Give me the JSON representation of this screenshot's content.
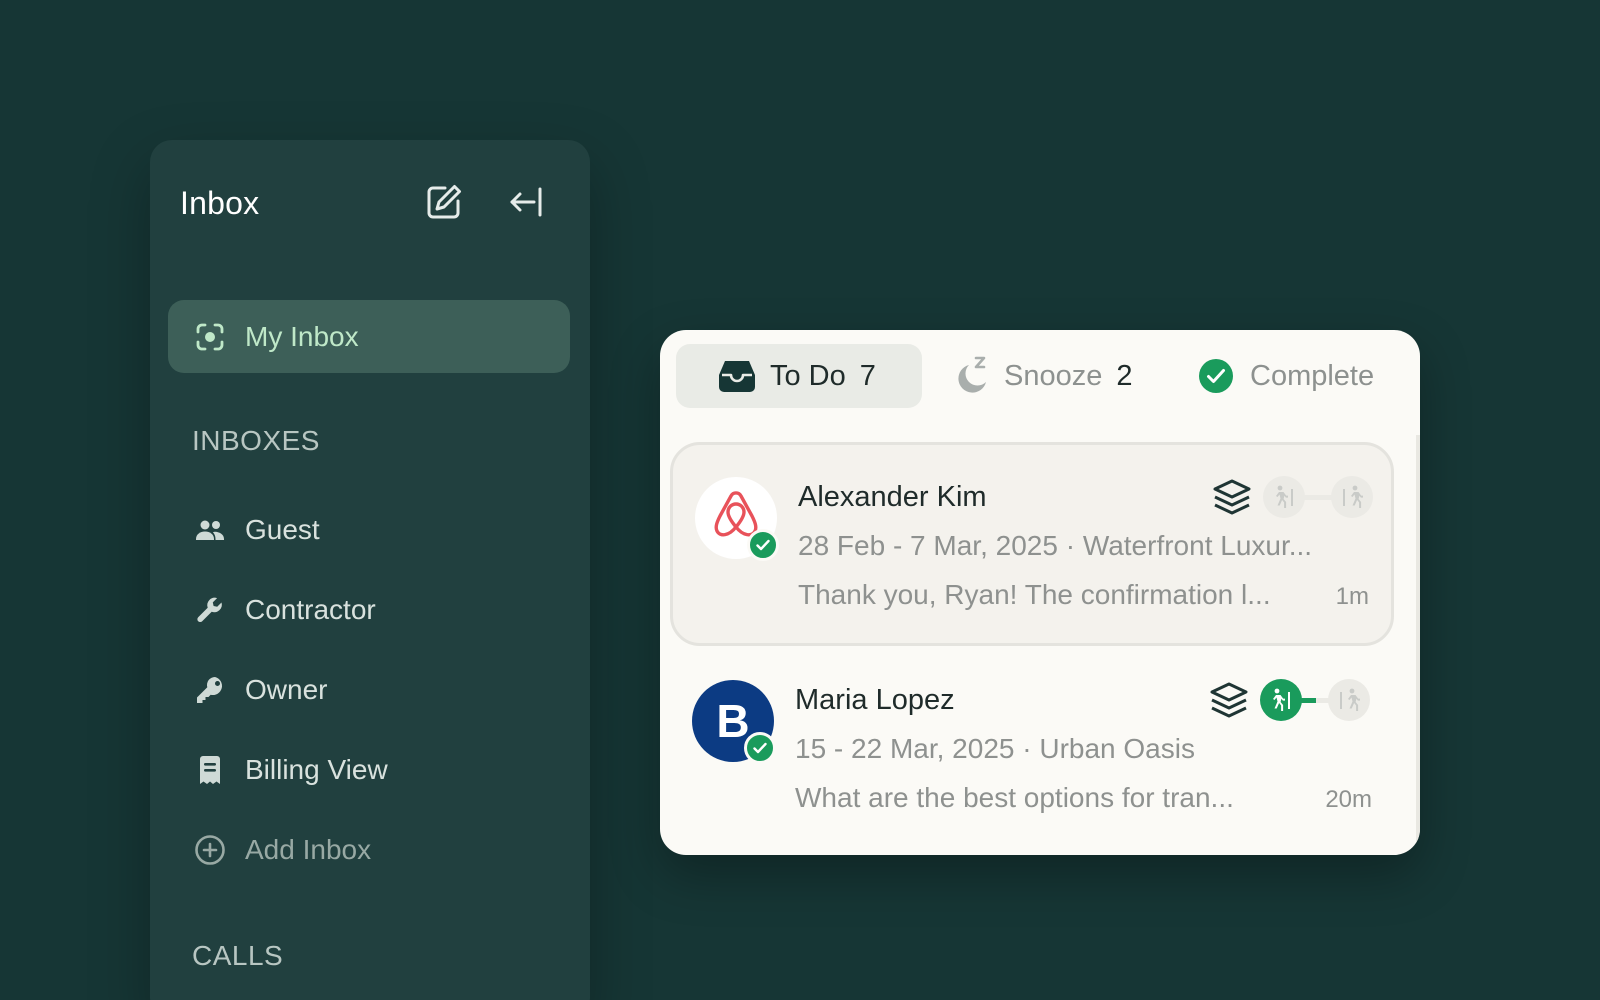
{
  "sidebar": {
    "title": "Inbox",
    "compose_icon": "compose-icon",
    "collapse_icon": "collapse-left-icon",
    "active_item": {
      "label": "My Inbox",
      "icon": "focus-icon"
    },
    "sections": [
      {
        "label": "INBOXES",
        "items": [
          {
            "label": "Guest",
            "icon": "people-icon"
          },
          {
            "label": "Contractor",
            "icon": "wrench-icon"
          },
          {
            "label": "Owner",
            "icon": "key-icon"
          },
          {
            "label": "Billing View",
            "icon": "receipt-icon"
          },
          {
            "label": "Add Inbox",
            "icon": "plus-circle-icon"
          }
        ]
      },
      {
        "label": "CALLS",
        "items": []
      }
    ]
  },
  "panel": {
    "tabs": [
      {
        "label": "To Do",
        "count": "7",
        "icon": "inbox-tray-icon",
        "active": true
      },
      {
        "label": "Snooze",
        "count": "2",
        "icon": "snooze-moon-icon",
        "active": false
      },
      {
        "label": "Complete",
        "count": "",
        "icon": "check-circle-icon",
        "active": false
      }
    ],
    "conversations": [
      {
        "name": "Alexander Kim",
        "meta": "28 Feb - 7 Mar, 2025 · Waterfront Luxur...",
        "message": "Thank you, Ryan! The confirmation l...",
        "time": "1m",
        "source": "airbnb",
        "selected": true,
        "checked_in": false
      },
      {
        "name": "Maria Lopez",
        "meta": "15 - 22 Mar, 2025 · Urban Oasis",
        "message": "What are the best options for tran...",
        "time": "20m",
        "source": "booking",
        "avatar_letter": "B",
        "selected": false,
        "checked_in": true
      }
    ]
  },
  "colors": {
    "background": "#163635",
    "sidebar": "#21403f",
    "active_nav": "#3d5f58",
    "accent_green": "#1a9b5c",
    "airbnb": "#e8525a",
    "booking": "#0c3b83"
  }
}
